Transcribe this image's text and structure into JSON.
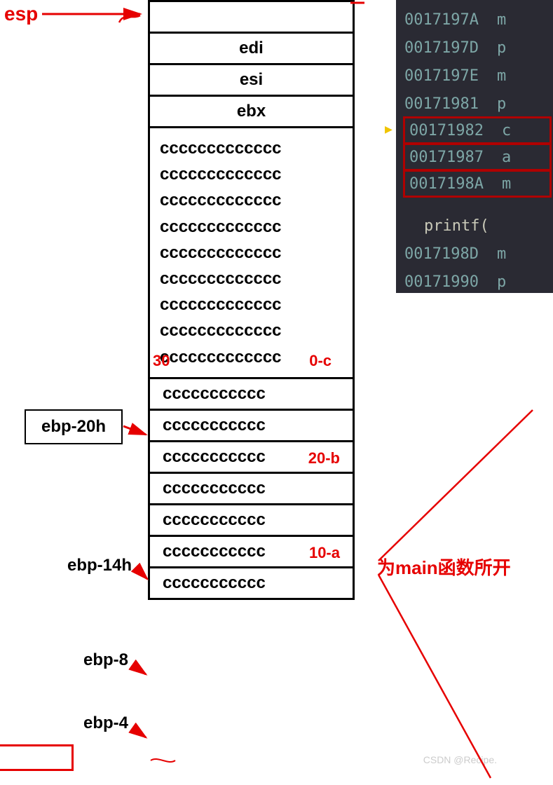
{
  "pointers": {
    "esp": "esp",
    "ebp20h": "ebp-20h",
    "ebp14h": "ebp-14h",
    "ebp8": "ebp-8",
    "ebp4": "ebp-4"
  },
  "registers": {
    "edi": "edi",
    "esi": "esi",
    "ebx": "ebx"
  },
  "cc_long": "ccccccccccccc",
  "cc_short": "ccccccccccc",
  "overlays": {
    "v30": "30",
    "zeroc": "0-c",
    "v20b": "20-b",
    "v10a": "10-a"
  },
  "ide": {
    "lines": [
      {
        "addr": "0017197A",
        "op": "m"
      },
      {
        "addr": "0017197D",
        "op": "p"
      },
      {
        "addr": "0017197E",
        "op": "m"
      },
      {
        "addr": "00171981",
        "op": "p"
      }
    ],
    "boxed": [
      {
        "addr": "00171982",
        "op": "c"
      },
      {
        "addr": "00171987",
        "op": "a"
      },
      {
        "addr": "0017198A",
        "op": "m"
      }
    ],
    "code": "printf(",
    "after": [
      {
        "addr": "0017198D",
        "op": "m"
      },
      {
        "addr": "00171990",
        "op": "p"
      }
    ]
  },
  "caption": "为main函数所开",
  "watermark": "CSDN @Recipe."
}
